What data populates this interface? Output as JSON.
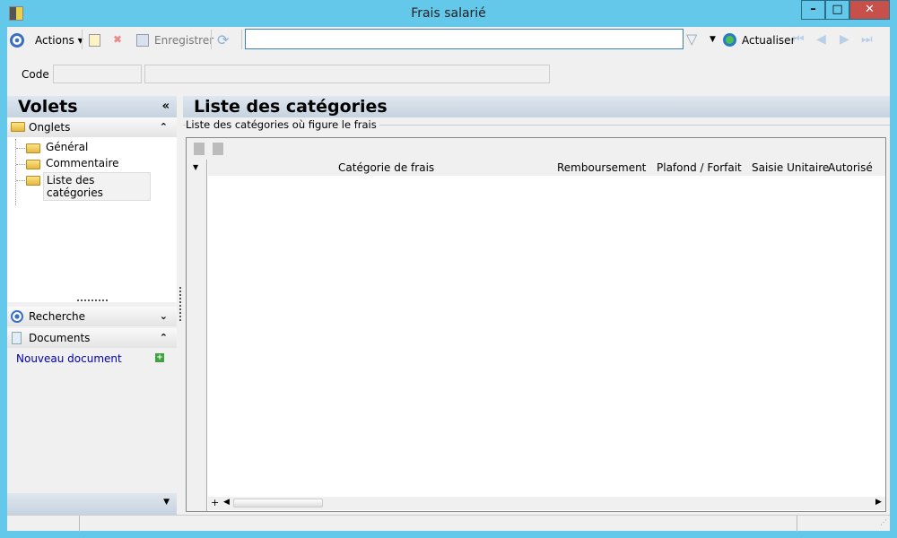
{
  "window": {
    "title": "Frais salarié"
  },
  "toolbar": {
    "actions_label": "Actions",
    "save_label": "Enregistrer",
    "search_value": "",
    "refresh_label": "Actualiser"
  },
  "header": {
    "code_label": "Code :",
    "code_value": "",
    "name_value": ""
  },
  "sidebar": {
    "title": "Volets",
    "onglets_label": "Onglets",
    "items": [
      {
        "label": "Général"
      },
      {
        "label": "Commentaire"
      },
      {
        "label": "Liste des catégories"
      }
    ],
    "recherche_label": "Recherche",
    "documents_label": "Documents",
    "new_document_label": "Nouveau document"
  },
  "main": {
    "title": "Liste des catégories",
    "group_label": "Liste des catégories où figure le frais",
    "columns": [
      "Catégorie de frais",
      "Remboursement",
      "Plafond / Forfait",
      "Saisie Unitaire",
      "Autorisé"
    ]
  },
  "colors": {
    "frame": "#64c8eb",
    "link": "#0000aa"
  }
}
